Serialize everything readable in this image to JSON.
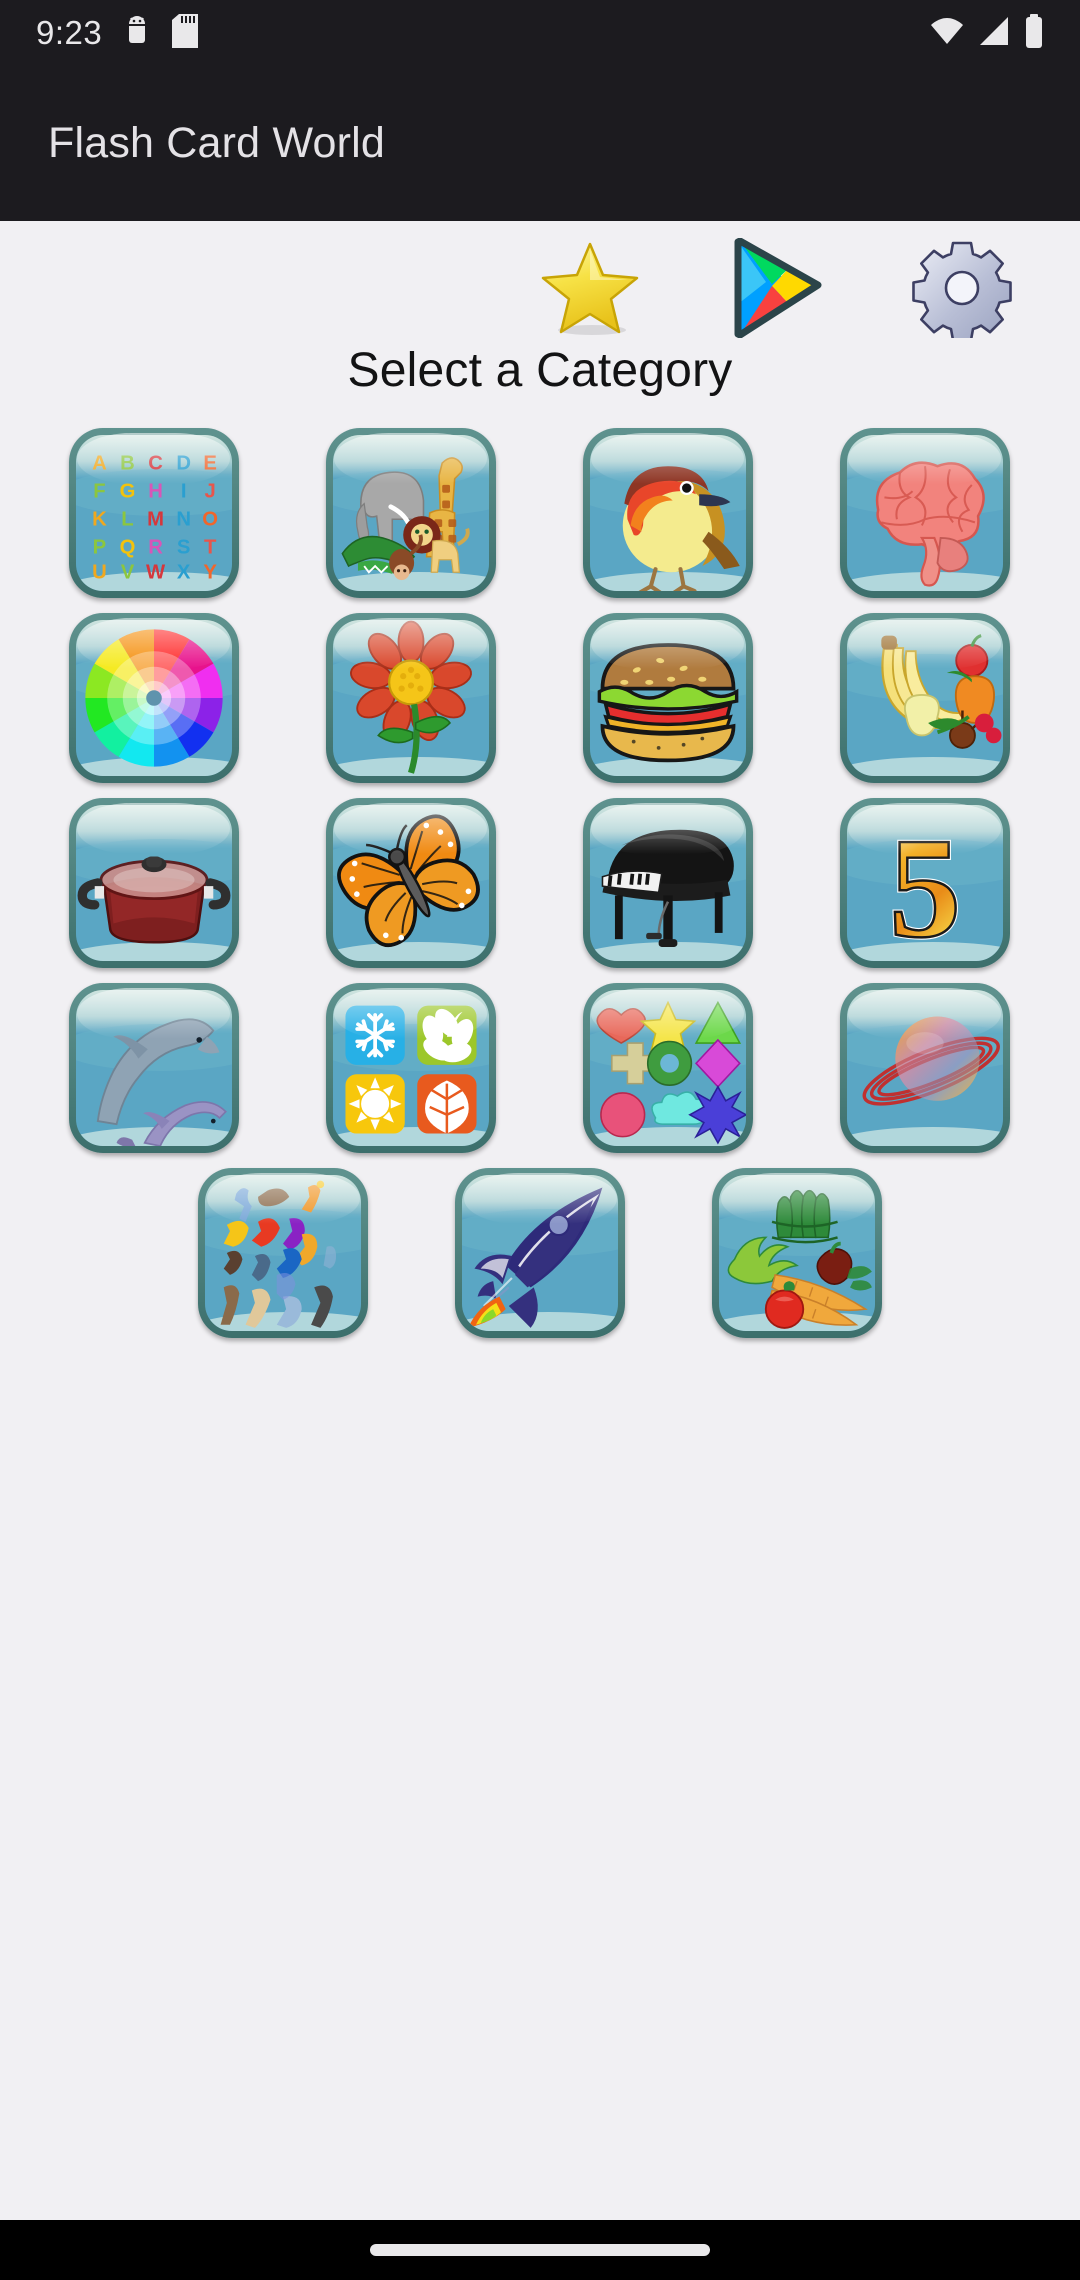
{
  "status_bar": {
    "time": "9:23",
    "icons": [
      "android-debug-icon",
      "sd-card-icon",
      "wifi-icon",
      "cellular-signal-icon",
      "battery-icon"
    ]
  },
  "app_bar": {
    "title": "Flash Card World"
  },
  "toolbar": {
    "items": [
      {
        "name": "favorites-star-icon",
        "label": "Favorites"
      },
      {
        "name": "google-play-icon",
        "label": "Google Play"
      },
      {
        "name": "settings-gear-icon",
        "label": "Settings"
      }
    ]
  },
  "main": {
    "heading": "Select a Category",
    "categories": [
      {
        "id": "alphabet",
        "label": "Alphabet",
        "icon": "alphabet-letters-icon"
      },
      {
        "id": "animals",
        "label": "Animals",
        "icon": "animals-icon"
      },
      {
        "id": "birds",
        "label": "Birds",
        "icon": "bird-robin-icon"
      },
      {
        "id": "body",
        "label": "Body",
        "icon": "brain-icon"
      },
      {
        "id": "colors",
        "label": "Colors",
        "icon": "color-wheel-icon"
      },
      {
        "id": "flowers",
        "label": "Flowers",
        "icon": "flower-icon"
      },
      {
        "id": "food",
        "label": "Food",
        "icon": "hamburger-icon"
      },
      {
        "id": "fruit",
        "label": "Fruit",
        "icon": "fruit-basket-icon"
      },
      {
        "id": "kitchen",
        "label": "Kitchen",
        "icon": "cooking-pot-icon"
      },
      {
        "id": "insects",
        "label": "Insects",
        "icon": "butterfly-icon"
      },
      {
        "id": "instruments",
        "label": "Instruments",
        "icon": "grand-piano-icon"
      },
      {
        "id": "numbers",
        "label": "Numbers",
        "icon": "number-five-icon"
      },
      {
        "id": "ocean",
        "label": "Ocean",
        "icon": "dolphins-icon"
      },
      {
        "id": "seasons",
        "label": "Seasons",
        "icon": "seasons-four-squares-icon"
      },
      {
        "id": "shapes",
        "label": "Shapes",
        "icon": "shapes-grid-icon"
      },
      {
        "id": "space",
        "label": "Space",
        "icon": "planet-saturn-icon"
      },
      {
        "id": "sports",
        "label": "Sports",
        "icon": "sports-silhouettes-icon"
      },
      {
        "id": "transport",
        "label": "Transport",
        "icon": "rocket-icon"
      },
      {
        "id": "vegetables",
        "label": "Vegetables",
        "icon": "vegetables-icon"
      }
    ]
  },
  "nav_bar": {
    "gesture_pill": "home-gesture-pill"
  },
  "colors": {
    "status_bar_bg": "#1c1b1f",
    "app_bar_bg": "#1c1b1f",
    "app_bar_text": "#e4e2e6",
    "page_bg": "#f1f0f3",
    "heading_text": "#131314",
    "tile_frame": "#4a817d",
    "tile_sky": "#5aa6c4",
    "nav_bar_bg": "#000000"
  }
}
